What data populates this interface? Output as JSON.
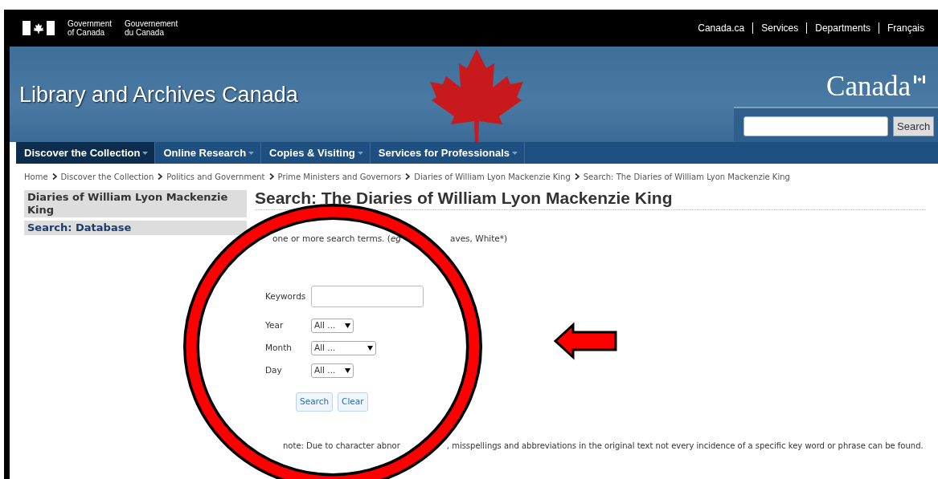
{
  "gov_bar": {
    "signature_en": [
      "Government",
      "of Canada"
    ],
    "signature_fr": [
      "Gouvernement",
      "du Canada"
    ],
    "links": [
      "Canada.ca",
      "Services",
      "Departments",
      "Français"
    ]
  },
  "banner": {
    "title": "Library and Archives Canada",
    "wordmark": "Canada",
    "search_button": "Search"
  },
  "nav": [
    {
      "label": "Discover the Collection",
      "selected": true
    },
    {
      "label": "Online Research",
      "selected": false
    },
    {
      "label": "Copies & Visiting",
      "selected": false
    },
    {
      "label": "Services for Professionals",
      "selected": false
    }
  ],
  "breadcrumb": [
    "Home",
    "Discover the Collection",
    "Politics and Government",
    "Prime Ministers and Governors",
    "Diaries of William Lyon Mackenzie King",
    "Search: The Diaries of William Lyon Mackenzie King"
  ],
  "sidebar": {
    "items": [
      {
        "label": "Diaries of William Lyon Mackenzie King",
        "kind": "heading"
      },
      {
        "label": "Search: Database",
        "kind": "link"
      }
    ]
  },
  "main": {
    "heading": "Search: The Diaries of William Lyon Mackenzie King",
    "instruction_fragments": [
      "one or more search terms. (*eg*",
      "aves, White*)"
    ],
    "fields": [
      {
        "label": "Keywords",
        "kind": "text"
      },
      {
        "label": "Year",
        "kind": "select",
        "value": "All ..."
      },
      {
        "label": "Month",
        "kind": "select",
        "value": "All ..."
      },
      {
        "label": "Day",
        "kind": "select",
        "value": "All ..."
      }
    ],
    "buttons": [
      "Search",
      "Clear"
    ],
    "note_fragments": [
      "note: Due to character abnor",
      ", misspellings and abbreviations in the original text not every incidence of a specific key word or phrase can be found."
    ]
  }
}
